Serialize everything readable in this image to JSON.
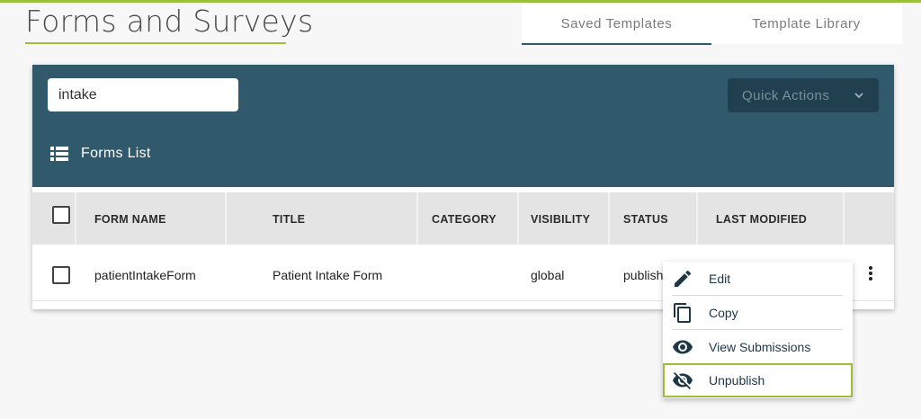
{
  "page": {
    "title": "Forms and Surveys"
  },
  "tabs": [
    {
      "label": "Saved Templates",
      "active": true
    },
    {
      "label": "Template Library",
      "active": false
    }
  ],
  "toolbar": {
    "search_value": "intake",
    "quick_actions_label": "Quick Actions",
    "list_label": "Forms List"
  },
  "table": {
    "columns": [
      "FORM NAME",
      "TITLE",
      "CATEGORY",
      "VISIBILITY",
      "STATUS",
      "LAST MODIFIED"
    ],
    "rows": [
      {
        "form_name": "patientIntakeForm",
        "title": "Patient Intake Form",
        "category": "",
        "visibility": "global",
        "status": "publish",
        "last_modified": ""
      }
    ]
  },
  "context_menu": {
    "items": [
      {
        "label": "Edit",
        "icon": "pencil-icon"
      },
      {
        "label": "Copy",
        "icon": "copy-icon"
      },
      {
        "label": "View Submissions",
        "icon": "eye-icon"
      },
      {
        "label": "Unpublish",
        "icon": "eye-off-icon"
      }
    ]
  },
  "colors": {
    "accent": "#9bbf3a",
    "header": "#305a6c",
    "quick_actions_bg": "#21404f",
    "icon": "#1d3746"
  }
}
